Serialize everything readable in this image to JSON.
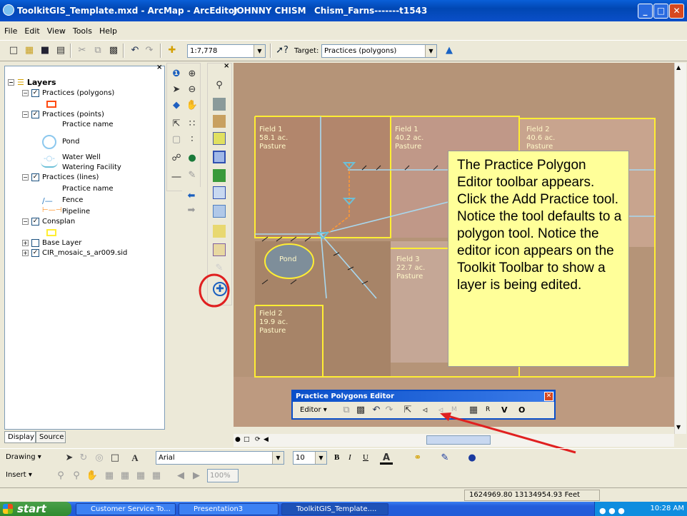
{
  "window": {
    "title": "ToolkitGIS_Template.mxd - ArcMap - ArcEditor",
    "user": "JOHNNY CHISM",
    "project": "Chism_Farns-------t1543",
    "buttons": {
      "minimize": "_",
      "maximize": "□",
      "close": "✕"
    }
  },
  "menu": [
    "File",
    "Edit",
    "View",
    "Tools",
    "Help"
  ],
  "standard_toolbar": {
    "scale": "1:7,778",
    "target_label": "Target:",
    "target_value": "Practices (polygons)"
  },
  "toc": {
    "root": "Layers",
    "items": [
      {
        "label": "Practices (polygons)"
      },
      {
        "label": "Practices (points)"
      },
      {
        "label": "Practice name"
      },
      {
        "label": "Pond"
      },
      {
        "label": "Water Well"
      },
      {
        "label": "Watering Facility"
      },
      {
        "label": "Practices (lines)"
      },
      {
        "label": "Practice name"
      },
      {
        "label": "Fence"
      },
      {
        "label": "Pipeline"
      },
      {
        "label": "Consplan"
      },
      {
        "label": "Base Layer"
      },
      {
        "label": "CIR_mosaic_s_ar009.sid"
      }
    ],
    "tabs": [
      "Display",
      "Source"
    ]
  },
  "map": {
    "fields": [
      {
        "text": "Field 1\n58.1 ac.\nPasture"
      },
      {
        "text": "Field 1\n40.2 ac.\nPasture"
      },
      {
        "text": "Field 2\n40.6 ac.\nPasture"
      },
      {
        "text": "Field 3\n22.7 ac.\nPasture"
      },
      {
        "text": "Field 2\n19.9 ac.\nPasture"
      }
    ],
    "pond_label": "Pond"
  },
  "callout": {
    "text": "The Practice Polygon Editor toolbar appears. Click the Add Practice tool. Notice the tool defaults to a polygon tool. Notice the editor icon appears on the Toolkit Toolbar to show a layer is being edited."
  },
  "editor_toolbar": {
    "title": "Practice Polygons Editor",
    "editor_menu": "Editor ▾",
    "letters": [
      "M",
      "R",
      "V",
      "O"
    ]
  },
  "drawing_toolbar": {
    "drawing_label": "Drawing ▾",
    "font": "Arial",
    "size": "10",
    "bold": "B",
    "italic": "I",
    "underline": "U"
  },
  "insert_toolbar": {
    "insert_label": "Insert ▾",
    "zoom": "100%"
  },
  "status": {
    "coords": "1624969.80  13134954.93 Feet"
  },
  "taskbar": {
    "start": "start",
    "tasks": [
      "Customer Service To...",
      "Presentation3",
      "ToolkitGIS_Template...."
    ],
    "clock": "10:28 AM"
  },
  "colors": {
    "field_boundary": "#ffee33",
    "annotation_circle": "#e02020",
    "pointer_arrow": "#e02020",
    "callout_bg": "#ffff99",
    "fence_line": "#1a1a1a",
    "pipeline": "#ff9933",
    "water_line": "#a8d8f0"
  }
}
